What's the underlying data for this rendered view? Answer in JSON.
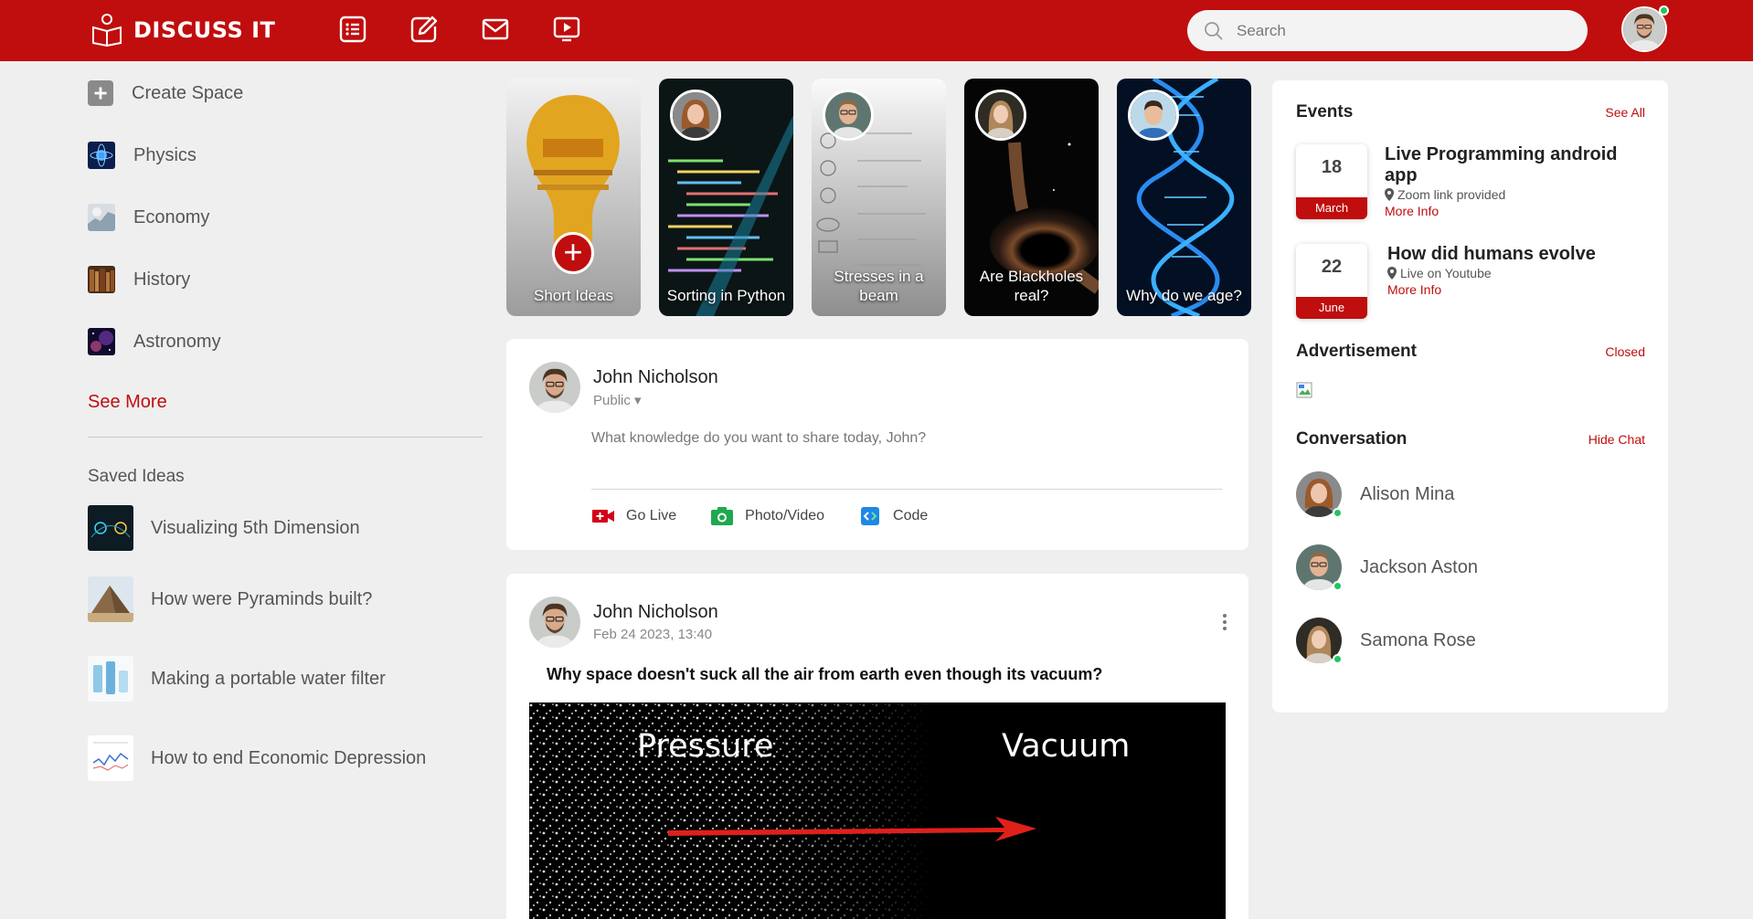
{
  "header": {
    "brand": "DISCUSS IT",
    "nav_icons": [
      "feed-list-icon",
      "edit-icon",
      "mail-icon",
      "video-icon"
    ],
    "search_placeholder": "Search",
    "accent_color": "#c00d0d"
  },
  "sidebar": {
    "spaces": [
      {
        "label": "Create Space",
        "icon": "plus-icon"
      },
      {
        "label": "Physics",
        "icon": "physics-thumbnail"
      },
      {
        "label": "Economy",
        "icon": "economy-thumbnail"
      },
      {
        "label": "History",
        "icon": "history-thumbnail"
      },
      {
        "label": "Astronomy",
        "icon": "astronomy-thumbnail"
      }
    ],
    "see_more": "See More",
    "saved_title": "Saved Ideas",
    "saved": [
      {
        "label": "Visualizing 5th Dimension"
      },
      {
        "label": "How were Pyraminds built?"
      },
      {
        "label": "Making a portable water filter"
      },
      {
        "label": "How to end Economic Depression"
      }
    ]
  },
  "stories": [
    {
      "label": "Short Ideas"
    },
    {
      "label": "Sorting in Python"
    },
    {
      "label": "Stresses in a beam"
    },
    {
      "label": "Are Blackholes real?"
    },
    {
      "label": "Why do we age?"
    }
  ],
  "composer": {
    "name": "John Nicholson",
    "visibility": "Public",
    "placeholder": "What knowledge do you want to share today, John?",
    "actions": [
      {
        "label": "Go Live",
        "icon": "video-camera-icon",
        "color": "#d0021b"
      },
      {
        "label": "Photo/Video",
        "icon": "camera-icon",
        "color": "#1fa84f"
      },
      {
        "label": "Code",
        "icon": "code-icon",
        "color": "#1e88e5"
      }
    ]
  },
  "post": {
    "name": "John Nicholson",
    "date": "Feb 24 2023, 13:40",
    "title": "Why space doesn't suck all the air from earth even though its vacuum?",
    "image_left_text": "Pressure",
    "image_right_text": "Vacuum"
  },
  "events": {
    "title": "Events",
    "link": "See All",
    "items": [
      {
        "day": "18",
        "month": "March",
        "title": "Live Programming android app",
        "location": "Zoom link provided",
        "more": "More Info"
      },
      {
        "day": "22",
        "month": "June",
        "title": "How did humans evolve",
        "location": "Live on Youtube",
        "more": "More Info"
      }
    ]
  },
  "advertisement": {
    "title": "Advertisement",
    "link": "Closed"
  },
  "conversation": {
    "title": "Conversation",
    "link": "Hide Chat",
    "contacts": [
      {
        "name": "Alison Mina",
        "online": true
      },
      {
        "name": "Jackson Aston",
        "online": true
      },
      {
        "name": "Samona Rose",
        "online": true
      }
    ]
  }
}
